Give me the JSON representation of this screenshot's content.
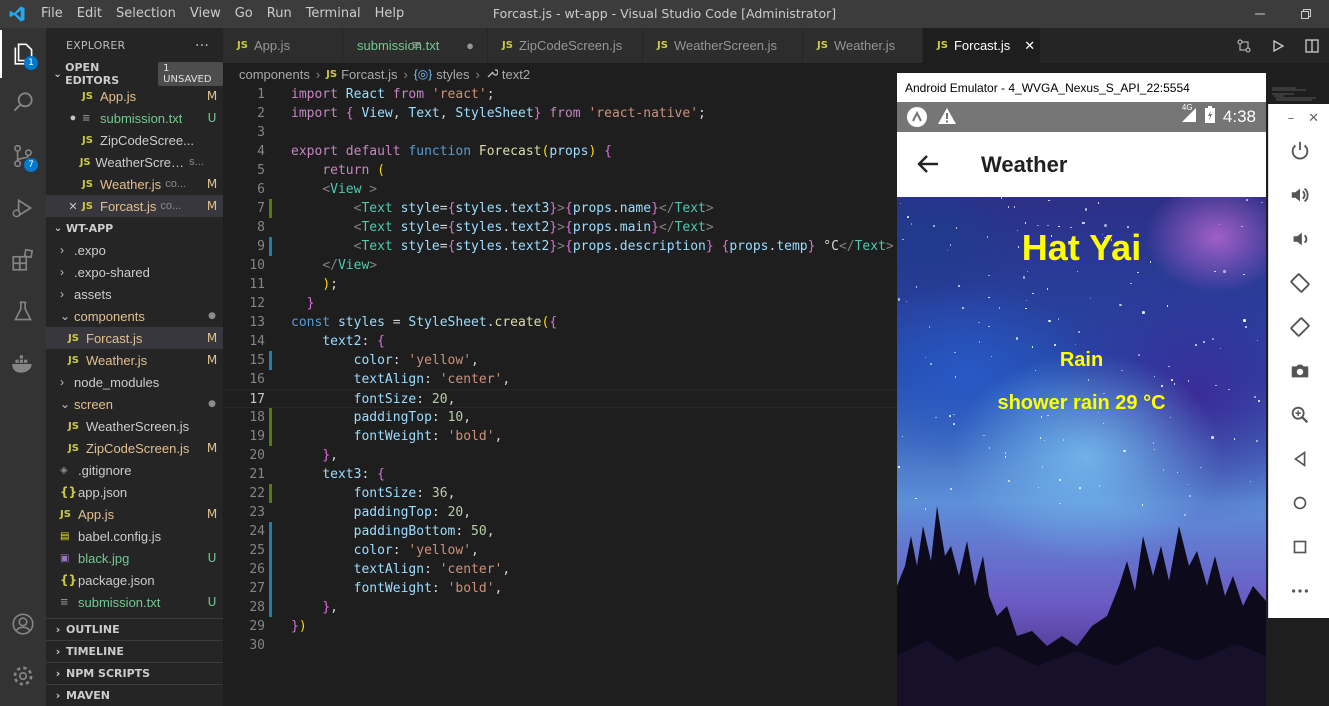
{
  "window": {
    "title": "Forcast.js - wt-app - Visual Studio Code [Administrator]",
    "menu": [
      "File",
      "Edit",
      "Selection",
      "View",
      "Go",
      "Run",
      "Terminal",
      "Help"
    ]
  },
  "activity": {
    "explorer_badge": "1",
    "scm_badge": "7"
  },
  "sidebar": {
    "title": "EXPLORER",
    "more": "···",
    "open_editors_label": "OPEN EDITORS",
    "unsaved_badge": "1 UNSAVED",
    "open_editors": [
      {
        "icon": "JS",
        "name": "App.js",
        "desc": "",
        "status": "M",
        "marker": ""
      },
      {
        "icon": "≡",
        "name": "submission.txt",
        "desc": "",
        "status": "U",
        "marker": "●"
      },
      {
        "icon": "JS",
        "name": "ZipCodeScree...",
        "desc": "",
        "status": "",
        "marker": ""
      },
      {
        "icon": "JS",
        "name": "WeatherScreen.js",
        "desc": "s...",
        "status": "",
        "marker": ""
      },
      {
        "icon": "JS",
        "name": "Weather.js",
        "desc": "co...",
        "status": "M",
        "marker": ""
      },
      {
        "icon": "JS",
        "name": "Forcast.js",
        "desc": "co...",
        "status": "M",
        "marker": "✕"
      }
    ],
    "project_label": "WT-APP",
    "tree": [
      {
        "indent": 1,
        "chev": "›",
        "icon": "",
        "name": ".expo",
        "status": ""
      },
      {
        "indent": 1,
        "chev": "›",
        "icon": "",
        "name": ".expo-shared",
        "status": ""
      },
      {
        "indent": 1,
        "chev": "›",
        "icon": "",
        "name": "assets",
        "status": ""
      },
      {
        "indent": 1,
        "chev": "⌄",
        "icon": "",
        "name": "components",
        "status": "●"
      },
      {
        "indent": 2,
        "chev": "",
        "icon": "JS",
        "name": "Forcast.js",
        "status": "M"
      },
      {
        "indent": 2,
        "chev": "",
        "icon": "JS",
        "name": "Weather.js",
        "status": "M"
      },
      {
        "indent": 1,
        "chev": "›",
        "icon": "",
        "name": "node_modules",
        "status": ""
      },
      {
        "indent": 1,
        "chev": "⌄",
        "icon": "",
        "name": "screen",
        "status": "●"
      },
      {
        "indent": 2,
        "chev": "",
        "icon": "JS",
        "name": "WeatherScreen.js",
        "status": ""
      },
      {
        "indent": 2,
        "chev": "",
        "icon": "JS",
        "name": "ZipCodeScreen.js",
        "status": "M"
      },
      {
        "indent": 1,
        "chev": "",
        "icon": "◈",
        "name": ".gitignore",
        "status": ""
      },
      {
        "indent": 1,
        "chev": "",
        "icon": "{}",
        "name": "app.json",
        "status": ""
      },
      {
        "indent": 1,
        "chev": "",
        "icon": "JS",
        "name": "App.js",
        "status": "M"
      },
      {
        "indent": 1,
        "chev": "",
        "icon": "▤",
        "name": "babel.config.js",
        "status": ""
      },
      {
        "indent": 1,
        "chev": "",
        "icon": "▣",
        "name": "black.jpg",
        "status": "U"
      },
      {
        "indent": 1,
        "chev": "",
        "icon": "{}",
        "name": "package.json",
        "status": ""
      },
      {
        "indent": 1,
        "chev": "",
        "icon": "≡",
        "name": "submission.txt",
        "status": "U"
      }
    ],
    "footer_sections": [
      "OUTLINE",
      "TIMELINE",
      "NPM SCRIPTS",
      "MAVEN"
    ]
  },
  "tabs": [
    {
      "icon": "JS",
      "label": "App.js",
      "mark": ""
    },
    {
      "icon": "≡",
      "label": "submission.txt",
      "mark": "●"
    },
    {
      "icon": "JS",
      "label": "ZipCodeScreen.js",
      "mark": ""
    },
    {
      "icon": "JS",
      "label": "WeatherScreen.js",
      "mark": ""
    },
    {
      "icon": "JS",
      "label": "Weather.js",
      "mark": ""
    },
    {
      "icon": "JS",
      "label": "Forcast.js",
      "mark": "✕"
    }
  ],
  "breadcrumb": [
    "components",
    "Forcast.js",
    "styles",
    "text2"
  ],
  "breadcrumb_icons": {
    "file": "JS",
    "styles": "{◎}",
    "text2": "🔧"
  },
  "code_lines": [
    "import React from 'react';",
    "import { View, Text, StyleSheet} from 'react-native';",
    "",
    "export default function Forecast(props) {",
    "    return (",
    "    <View >",
    "        <Text style={styles.text3}>{props.name}</Text>",
    "        <Text style={styles.text2}>{props.main}</Text>",
    "        <Text style={styles.text2}>{props.description} {props.temp} °C</Text>",
    "    </View>",
    "    );",
    "  }",
    "const styles = StyleSheet.create({",
    "    text2: {",
    "        color: 'yellow',",
    "        textAlign: 'center',",
    "        fontSize: 20,",
    "        paddingTop: 10,",
    "        fontWeight: 'bold',",
    "    },",
    "    text3: {",
    "        fontSize: 36,",
    "        paddingTop: 20,",
    "        paddingBottom: 50,",
    "        color: 'yellow',",
    "        textAlign: 'center',",
    "        fontWeight: 'bold',",
    "    },",
    "})",
    ""
  ],
  "gutter": {
    "modified_lines": [
      9,
      15,
      24,
      25,
      26,
      27,
      28
    ],
    "added_lines": [
      7,
      18,
      19,
      22
    ]
  },
  "emulator": {
    "title": "Android Emulator - 4_WVGA_Nexus_S_API_22:5554",
    "network": "4G",
    "time": "4:38",
    "app_title": "Weather",
    "city": "Hat Yai",
    "main": "Rain",
    "description": "shower rain 29 °C"
  },
  "colors": {
    "accent": "#007acc",
    "modified": "#e2c08d",
    "untracked": "#73c991",
    "weather_text": "#ffff00"
  }
}
